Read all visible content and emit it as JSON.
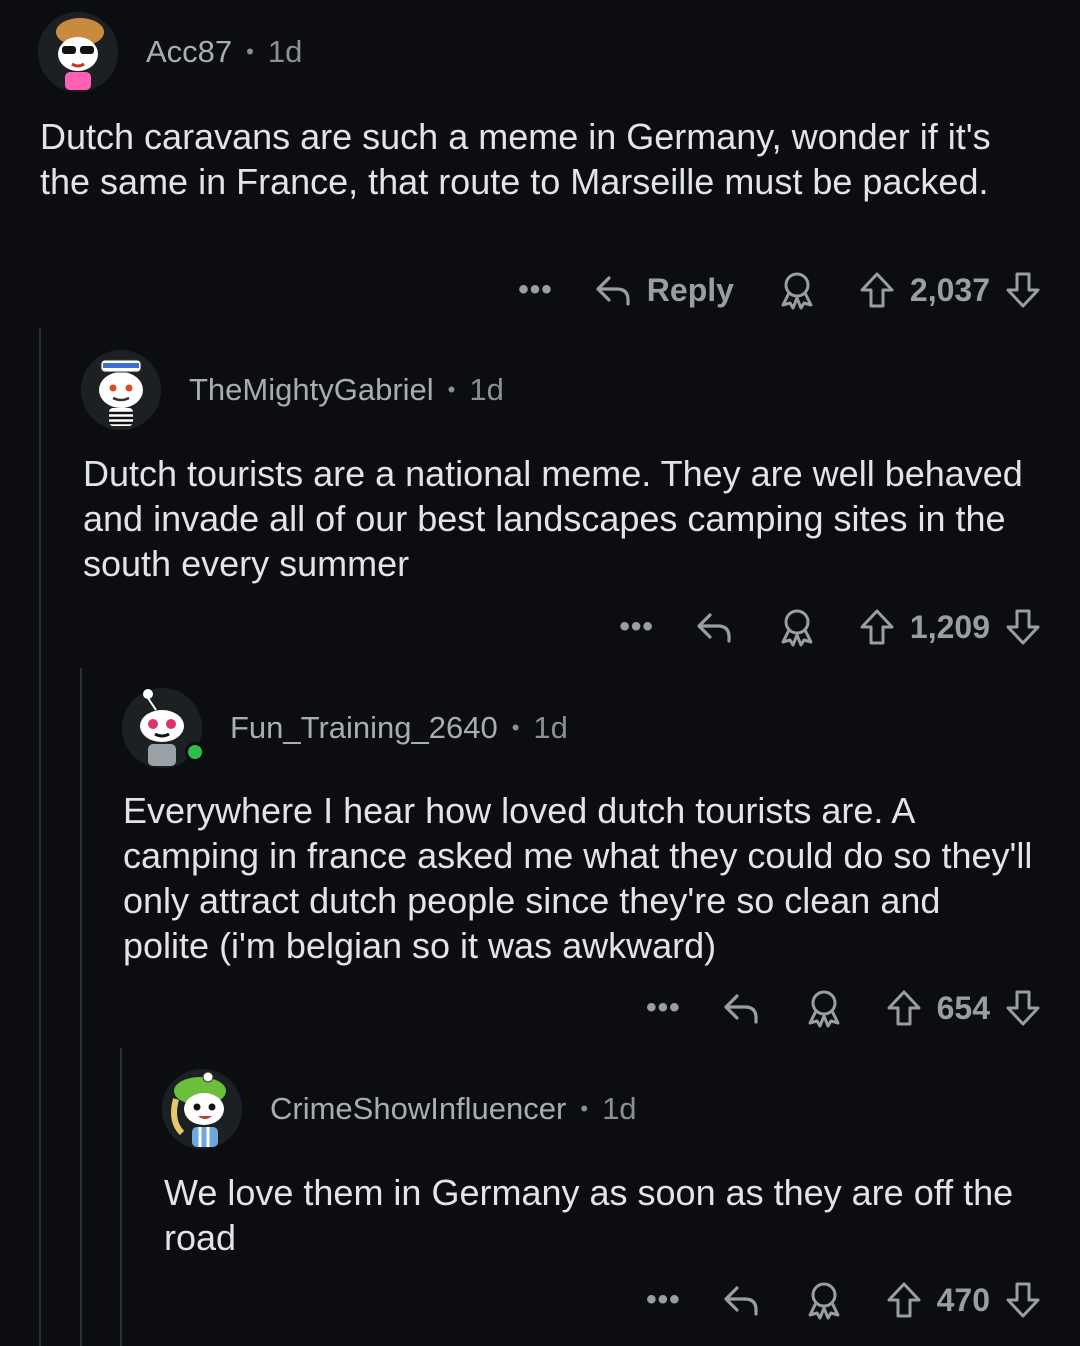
{
  "comments": [
    {
      "username": "Acc87",
      "age": "1d",
      "body": "Dutch caravans are such a meme in Germany, wonder if it's the same in France, that route to Marseille must be packed.",
      "reply_label": "Reply",
      "score": "2,037",
      "more": "•••"
    },
    {
      "username": "TheMightyGabriel",
      "age": "1d",
      "body": "Dutch tourists are a national meme. They are well behaved and invade all of our best landscapes camping sites in the south every summer",
      "score": "1,209",
      "more": "•••"
    },
    {
      "username": "Fun_Training_2640",
      "age": "1d",
      "online": true,
      "body": "Everywhere I hear how loved dutch tourists are. A camping in france asked me what they could do so they'll only attract dutch people since they're so clean and polite (i'm belgian so it was awkward)",
      "score": "654",
      "more": "•••"
    },
    {
      "username": "CrimeShowInfluencer",
      "age": "1d",
      "body": "We love them in Germany as soon as they are off the road",
      "score": "470",
      "more": "•••"
    }
  ],
  "separator": "•",
  "icons": {
    "reply": "reply-arrow-icon",
    "award": "award-icon",
    "upvote": "upvote-arrow-icon",
    "downvote": "downvote-arrow-icon"
  },
  "colors": {
    "background": "#0b0d10",
    "text": "#e2e4e6",
    "meta": "#8c9094",
    "online": "#2dbe4e"
  }
}
